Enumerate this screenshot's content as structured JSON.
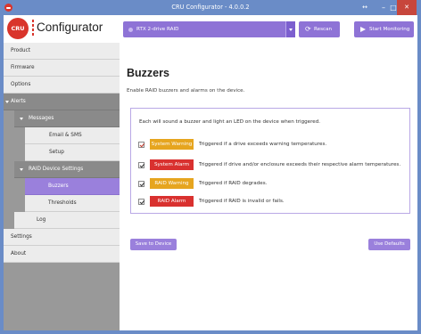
{
  "window": {
    "title": "CRU Configurator - 4.0.0.2",
    "restore_glyph": "↔",
    "minimize_glyph": "–",
    "maximize_glyph": "□",
    "close_glyph": "✕"
  },
  "header": {
    "logo_badge": "CRU",
    "logo_text": "Configurator",
    "device": "RTX 2-drive RAID",
    "rescan_icon": "⟳",
    "rescan_label": "Rescan",
    "monitor_label": "Start Monitoring"
  },
  "sidebar": {
    "items": [
      {
        "label": "Product"
      },
      {
        "label": "Firmware"
      },
      {
        "label": "Options"
      },
      {
        "label": "Alerts"
      },
      {
        "label": "Messages"
      },
      {
        "label": "Email & SMS"
      },
      {
        "label": "Setup"
      },
      {
        "label": "RAID Device Settings"
      },
      {
        "label": "Buzzers"
      },
      {
        "label": "Thresholds"
      },
      {
        "label": "Log"
      },
      {
        "label": "Settings"
      },
      {
        "label": "About"
      }
    ]
  },
  "main": {
    "title": "Buzzers",
    "description": "Enable RAID buzzers and alarms on the device.",
    "panel_intro": "Each will sound a buzzer and light an LED on the device when triggered.",
    "alarms": [
      {
        "label": "System Warning",
        "description": "Triggered if a drive exceeds warning temperatures.",
        "checked": true,
        "color": "#e6a51f"
      },
      {
        "label": "System Alarm",
        "description": "Triggered if drive and/or enclosure exceeds their respective alarm temperatures.",
        "checked": true,
        "color": "#d9312f"
      },
      {
        "label": "RAID Warning",
        "description": "Triggered if RAID degrades.",
        "checked": true,
        "color": "#e6a51f"
      },
      {
        "label": "RAID Alarm",
        "description": "Triggered if RAID is invalid or fails.",
        "checked": true,
        "color": "#d9312f"
      }
    ],
    "save_label": "Save to Device",
    "defaults_label": "Use Defaults"
  },
  "colors": {
    "accent": "#8e73d6",
    "selected": "#9a80dc",
    "brand_red": "#d9342b",
    "titlebar": "#6a8cc7"
  }
}
